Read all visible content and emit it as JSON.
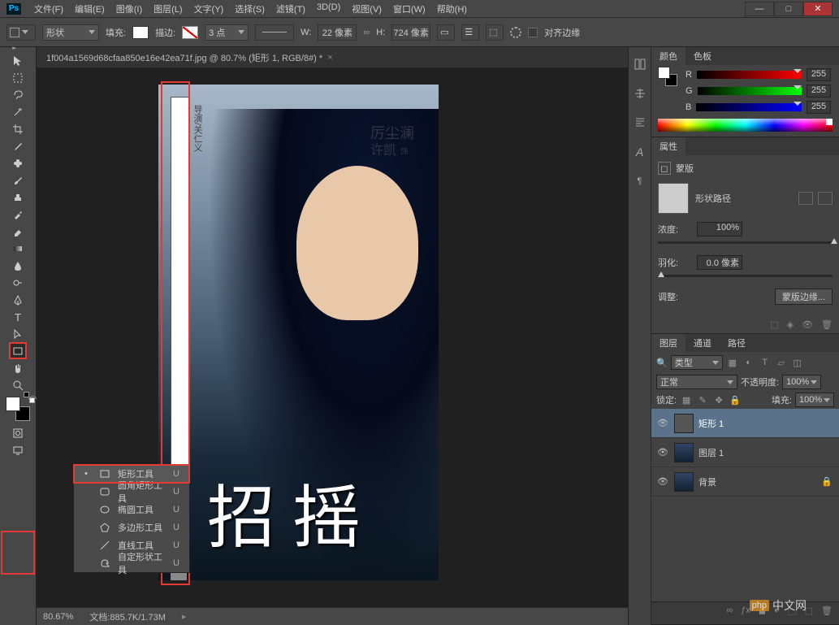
{
  "menubar": [
    "文件(F)",
    "编辑(E)",
    "图像(I)",
    "图层(L)",
    "文字(Y)",
    "选择(S)",
    "滤镜(T)",
    "3D(D)",
    "视图(V)",
    "窗口(W)",
    "帮助(H)"
  ],
  "options": {
    "shape_mode": "形状",
    "fill_label": "填充:",
    "stroke_label": "描边:",
    "stroke_width": "3 点",
    "w_label": "W:",
    "w_value": "22 像素",
    "h_label": "H:",
    "h_value": "724 像素",
    "align_label": "对齐边缘"
  },
  "doc": {
    "tab_title": "1f004a1569d68cfaa850e16e42ea71f.jpg @ 80.7% (矩形 1, RGB/8#) *",
    "brush_title": "招\n摇",
    "sub_name1": "厉尘澜",
    "sub_name2": "许凯",
    "sub_mid": "饰",
    "vert_label": "导演/关仁义"
  },
  "flyout": {
    "items": [
      {
        "label": "矩形工具",
        "key": "U",
        "sel": true
      },
      {
        "label": "圆角矩形工具",
        "key": "U"
      },
      {
        "label": "椭圆工具",
        "key": "U"
      },
      {
        "label": "多边形工具",
        "key": "U"
      },
      {
        "label": "直线工具",
        "key": "U"
      },
      {
        "label": "自定形状工具",
        "key": "U"
      }
    ]
  },
  "status": {
    "zoom": "80.67%",
    "doc_label": "文档:",
    "doc_size": "885.7K/1.73M"
  },
  "panels": {
    "color": {
      "tab_color": "颜色",
      "tab_swatch": "色板",
      "r": "R",
      "g": "G",
      "b": "B",
      "val": "255"
    },
    "props": {
      "tab": "属性",
      "mask": "蒙版",
      "shape_path": "形状路径",
      "density": "浓度:",
      "density_v": "100%",
      "feather": "羽化:",
      "feather_v": "0.0 像素",
      "adjust": "调整:",
      "mask_edge": "蒙版边缘..."
    },
    "layers": {
      "tab_layers": "图层",
      "tab_channels": "通道",
      "tab_paths": "路径",
      "kind": "类型",
      "blend": "正常",
      "opacity_label": "不透明度:",
      "opacity": "100%",
      "lock": "锁定:",
      "fill_label": "填充:",
      "fill": "100%",
      "items": [
        {
          "name": "矩形 1",
          "sel": true,
          "thumb": "shape"
        },
        {
          "name": "图层 1",
          "thumb": "img"
        },
        {
          "name": "背景",
          "thumb": "img",
          "locked": true
        }
      ]
    }
  },
  "watermark": {
    "badge": "php",
    "text": "中文网"
  }
}
